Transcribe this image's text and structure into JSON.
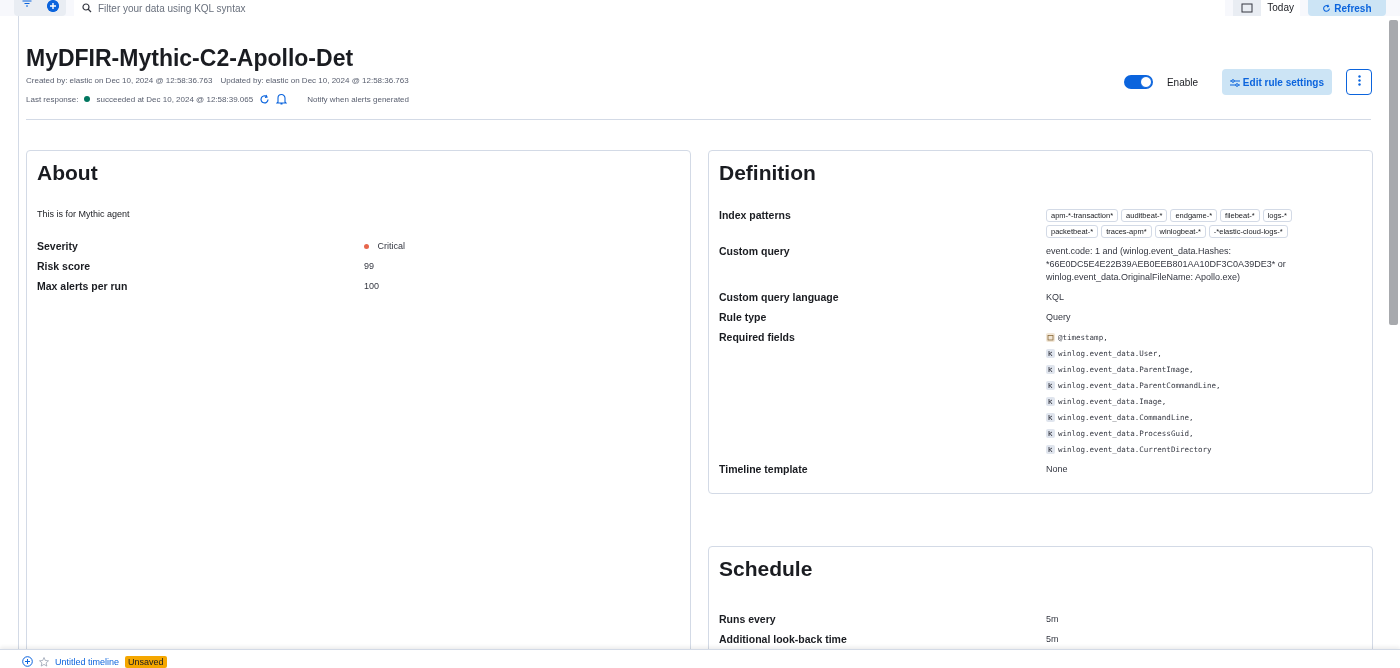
{
  "query_bar": {
    "placeholder": "Filter your data using KQL syntax",
    "date_label": "Today",
    "refresh_label": "Refresh"
  },
  "rule": {
    "title": "MyDFIR-Mythic-C2-Apollo-Det",
    "created": "Created by: elastic on Dec 10, 2024 @ 12:58:36.763",
    "updated": "Updated by: elastic on Dec 10, 2024 @ 12:58:36.763",
    "last_response_label": "Last response:",
    "status_text": "succeeded at Dec 10, 2024 @ 12:58:39.065",
    "notify": "Notify when alerts generated",
    "enabled": true,
    "enable_label": "Enable",
    "edit_button": "Edit rule settings"
  },
  "about": {
    "title": "About",
    "description": "This is for Mythic agent",
    "rows": [
      {
        "label": "Severity",
        "value": "Critical",
        "color": "#e7664c"
      },
      {
        "label": "Risk score",
        "value": "99"
      },
      {
        "label": "Max alerts per run",
        "value": "100"
      }
    ]
  },
  "definition": {
    "title": "Definition",
    "index_patterns_label": "Index patterns",
    "index_patterns": [
      "apm-*-transaction*",
      "auditbeat-*",
      "endgame-*",
      "filebeat-*",
      "logs-*",
      "packetbeat-*",
      "traces-apm*",
      "winlogbeat-*",
      "-*elastic-cloud-logs-*"
    ],
    "rows": [
      {
        "label": "Custom query",
        "value": "event.code: 1 and (winlog.event_data.Hashes: *66E0DC5E4E22B39AEB0EEB801AA10DF3C0A39DE3* or winlog.event_data.OriginalFileName: Apollo.exe)"
      },
      {
        "label": "Custom query language",
        "value": "KQL"
      },
      {
        "label": "Rule type",
        "value": "Query"
      }
    ],
    "required_fields_label": "Required fields",
    "required_fields": [
      {
        "kind": "date",
        "name": "@timestamp,"
      },
      {
        "kind": "keyword",
        "name": "winlog.event_data.User,"
      },
      {
        "kind": "keyword",
        "name": "winlog.event_data.ParentImage,"
      },
      {
        "kind": "keyword",
        "name": "winlog.event_data.ParentCommandLine,"
      },
      {
        "kind": "keyword",
        "name": "winlog.event_data.Image,"
      },
      {
        "kind": "keyword",
        "name": "winlog.event_data.CommandLine,"
      },
      {
        "kind": "keyword",
        "name": "winlog.event_data.ProcessGuid,"
      },
      {
        "kind": "keyword",
        "name": "winlog.event_data.CurrentDirectory"
      }
    ],
    "timeline_label": "Timeline template",
    "timeline_value": "None"
  },
  "schedule": {
    "title": "Schedule",
    "rows": [
      {
        "label": "Runs every",
        "value": "5m"
      },
      {
        "label": "Additional look-back time",
        "value": "5m"
      }
    ]
  },
  "timeline_bar": {
    "title": "Untitled timeline",
    "badge": "Unsaved"
  }
}
